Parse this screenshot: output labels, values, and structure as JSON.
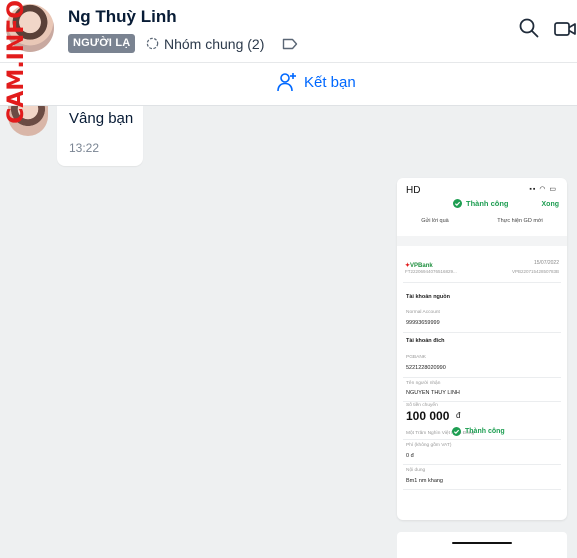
{
  "header": {
    "contact_name": "Ng Thuỳ Linh",
    "stranger_badge": "NGƯỜI LẠ",
    "common_groups": "Nhóm chung (2)",
    "watermark": "CAM.INFO",
    "icons": [
      "search-icon",
      "video-call-icon",
      "tag-icon",
      "group-icon"
    ]
  },
  "friend_bar": {
    "add_friend_label": "Kết bạn"
  },
  "messages": [
    {
      "text": "Vâng bạn",
      "time": "13:22"
    }
  ],
  "transfer_screenshot": {
    "status_carrier": "HD",
    "success_top": "Thành công",
    "done": "Xong",
    "action_left": "Gửi lời quà",
    "action_right": "Thực hiện GD mới",
    "bank": "VPBank",
    "date": "15/07/2022",
    "ref_left": "FT22206944076516829...",
    "ref_right": "VPB22071542850783B",
    "source_account_heading": "Tài khoản nguồn",
    "source_account_label": "Normal Account",
    "source_account_value": "99993659999",
    "dest_account_heading": "Tài khoản đích",
    "dest_bank_label": "PGBANK",
    "dest_account_value": "5221228020990",
    "recipient_label": "Tên người nhận",
    "recipient_value": "NGUYEN THUY LINH",
    "amount_label": "Số tiền chuyển",
    "amount_value": "100 000",
    "amount_currency": "đ",
    "amount_words": "Một Trăm Nghìn Việt Nam Đồng",
    "fee_label": "Phí (không gồm VAT)",
    "fee_value": "0 đ",
    "content_label": "Nội dung",
    "content_value": "Bm1 nm khang",
    "success_bottom": "Thành công"
  },
  "colors": {
    "accent": "#0068ff",
    "success": "#1e9e52",
    "watermark": "#e21b1b",
    "badge_bg": "#7a8391",
    "chat_bg": "#eef0f1"
  }
}
